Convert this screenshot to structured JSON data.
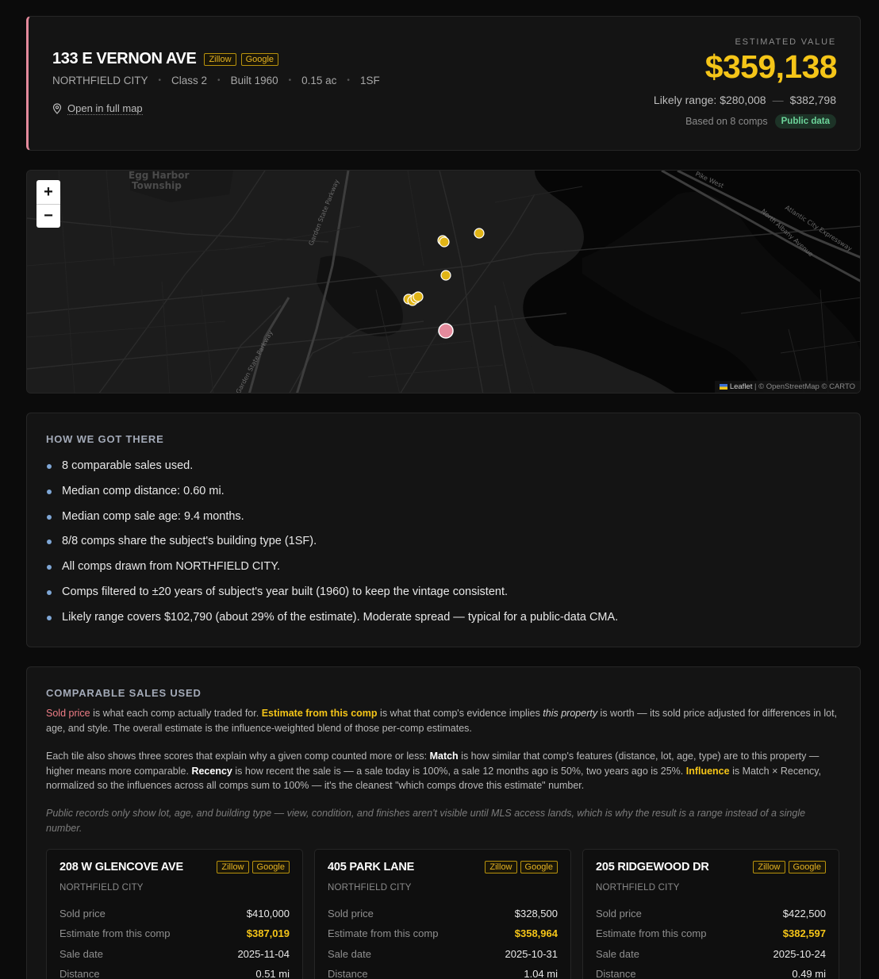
{
  "subject": {
    "address": "133 E VERNON AVE",
    "chips": [
      "Zillow",
      "Google"
    ],
    "city": "NORTHFIELD CITY",
    "class": "Class 2",
    "built": "Built 1960",
    "lot": "0.15 ac",
    "type": "1SF",
    "map_link": "Open in full map"
  },
  "estimate": {
    "label": "ESTIMATED VALUE",
    "value": "$359,138",
    "range_prefix": "Likely range: $280,008",
    "range_sep": "—",
    "range_high": "$382,798",
    "basis": "Based on 8 comps",
    "source_badge": "Public data"
  },
  "map": {
    "zoom_in": "+",
    "zoom_out": "−",
    "attribution_leaflet": "Leaflet",
    "attribution_rest": " | © OpenStreetMap © CARTO",
    "labels": {
      "township_1": "Egg Harbor",
      "township_2": "Township",
      "parkway_1": "Garden State Parkway",
      "parkway_2": "Garden State Parkway",
      "pike": "Pike West",
      "expressway": "Atlantic City Expressway",
      "albany": "North Albany Avenue"
    },
    "colors": {
      "comp": "#e0b416",
      "subject": "#e48a9c"
    }
  },
  "how": {
    "title": "HOW WE GOT THERE",
    "items": [
      "8 comparable sales used.",
      "Median comp distance: 0.60 mi.",
      "Median comp sale age: 9.4 months.",
      "8/8 comps share the subject's building type (1SF).",
      "All comps drawn from NORTHFIELD CITY.",
      "Comps filtered to ±20 years of subject's year built (1960) to keep the vintage consistent.",
      "Likely range covers $102,790 (about 29% of the estimate). Moderate spread — typical for a public-data CMA."
    ]
  },
  "comps": {
    "title": "COMPARABLE SALES USED",
    "p1": {
      "sold": "Sold price",
      "t1": " is what each comp actually traded for. ",
      "estcomp": "Estimate from this comp",
      "t2": " is what that comp's evidence implies ",
      "this_property": "this property",
      "t3": " is worth — its sold price adjusted for differences in lot, age, and style. The overall estimate is the influence-weighted blend of those per-comp estimates."
    },
    "p2": {
      "t1": "Each tile also shows three scores that explain why a given comp counted more or less: ",
      "match": "Match",
      "t2": " is how similar that comp's features (distance, lot, age, type) are to this property — higher means more comparable. ",
      "recency": "Recency",
      "t3": " is how recent the sale is — a sale today is 100%, a sale 12 months ago is 50%, two years ago is 25%. ",
      "influence": "Influence",
      "t4": " is Match × Recency, normalized so the influences across all comps sum to 100% — it's the cleanest \"which comps drove this estimate\" number."
    },
    "note": "Public records only show lot, age, and building type — view, condition, and finishes aren't visible until MLS access lands, which is why the result is a range instead of a single number.",
    "row_labels": {
      "sold": "Sold price",
      "estimate": "Estimate from this comp",
      "date": "Sale date",
      "distance": "Distance"
    },
    "tiles": [
      {
        "address": "208 W GLENCOVE AVE",
        "city": "NORTHFIELD CITY",
        "sold": "$410,000",
        "estimate": "$387,019",
        "date": "2025-11-04",
        "distance": "0.51 mi"
      },
      {
        "address": "405 PARK LANE",
        "city": "NORTHFIELD CITY",
        "sold": "$328,500",
        "estimate": "$358,964",
        "date": "2025-10-31",
        "distance": "1.04 mi"
      },
      {
        "address": "205 RIDGEWOOD DR",
        "city": "NORTHFIELD CITY",
        "sold": "$422,500",
        "estimate": "$382,597",
        "date": "2025-10-24",
        "distance": "0.49 mi"
      }
    ]
  }
}
